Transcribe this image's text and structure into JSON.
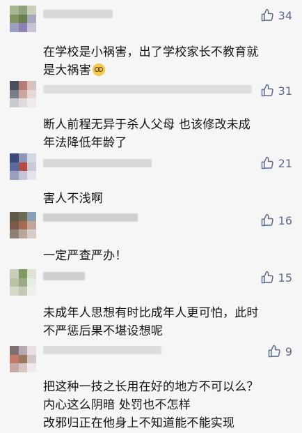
{
  "comments": [
    {
      "likes": "34",
      "text": "在学校是小祸害，出了学校家长不教育就\n是大祸害",
      "emoji": "face-with-monocle"
    },
    {
      "likes": "31",
      "text": "断人前程无异于杀人父母   也该修改未成\n年法降低年龄了"
    },
    {
      "likes": "21",
      "text": "害人不浅啊"
    },
    {
      "likes": "16",
      "text": "一定严查严办！"
    },
    {
      "likes": "15",
      "text": "未成年人思想有时比成年人更可怕，此时\n不严惩后果不堪设想呢"
    },
    {
      "likes": "9",
      "text": "把这种一技之长用在好的地方不可以么？\n内心这么阴暗 处罚也不怎样\n改邪归正在他身上不知道能不能实现"
    }
  ],
  "colors": {
    "like": "#5b6b8a",
    "background": "#f6f6f6",
    "text": "#111111"
  },
  "icons": {
    "like": "thumbs-up-icon"
  }
}
